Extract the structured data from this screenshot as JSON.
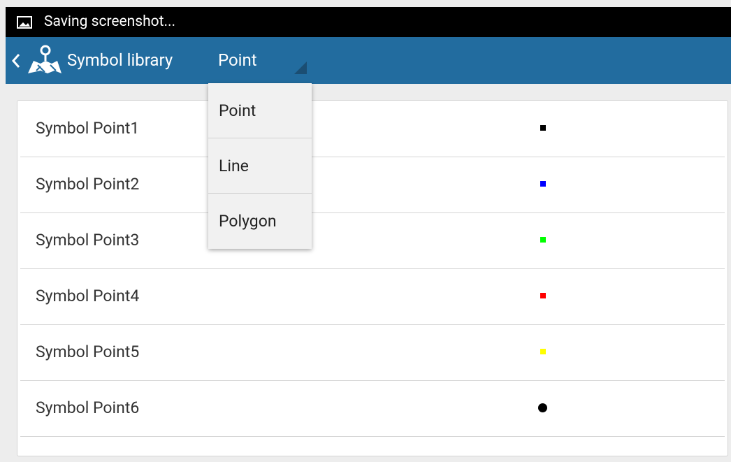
{
  "status_bar": {
    "notification_icon": "image-icon",
    "text": "Saving screenshot..."
  },
  "action_bar": {
    "back_icon": "chevron-left-icon",
    "app_icon": "map-pin-icon",
    "title": "Symbol library",
    "background": "#226c9f",
    "spinner": {
      "selected": "Point",
      "arrow_icon": "spinner-corner-arrow-icon"
    }
  },
  "symbols": [
    {
      "label": "Symbol Point1",
      "color": "#000000",
      "shape": "square"
    },
    {
      "label": "Symbol Point2",
      "color": "#0000ff",
      "shape": "square"
    },
    {
      "label": "Symbol Point3",
      "color": "#00ff00",
      "shape": "square"
    },
    {
      "label": "Symbol Point4",
      "color": "#ff0000",
      "shape": "square"
    },
    {
      "label": "Symbol Point5",
      "color": "#ffff00",
      "shape": "square"
    },
    {
      "label": "Symbol Point6",
      "color": "#000000",
      "shape": "circle"
    }
  ],
  "dropdown": {
    "options": [
      "Point",
      "Line",
      "Polygon"
    ]
  }
}
